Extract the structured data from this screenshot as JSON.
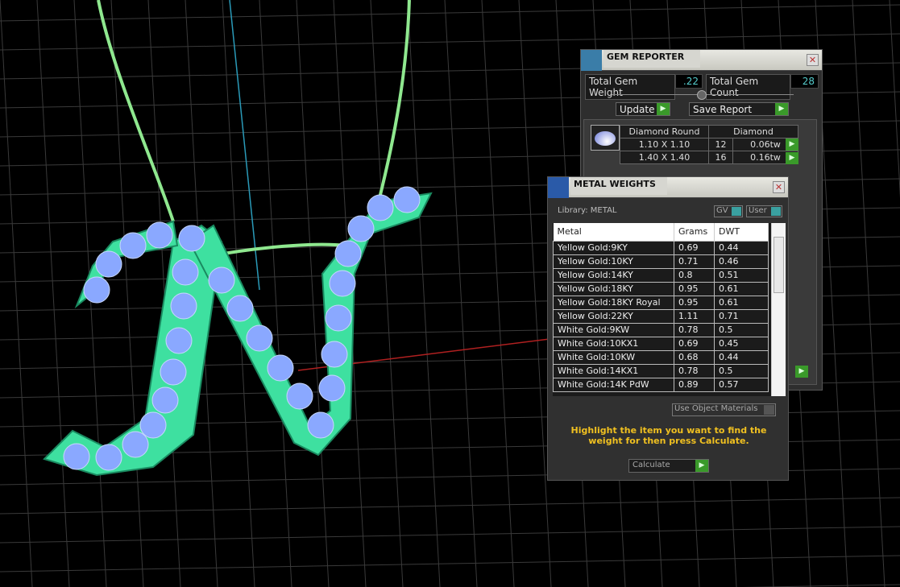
{
  "gem_reporter": {
    "title": "GEM REPORTER",
    "total_weight_label": "Total Gem Weight",
    "total_weight": ".22",
    "total_count_label": "Total Gem Count",
    "total_count": "28",
    "update_label": "Update",
    "save_label": "Save Report",
    "table_headers": [
      "Diamond Round",
      "Diamond"
    ],
    "rows": [
      {
        "size": "1.10 X 1.10",
        "count": "12",
        "weight": "0.06tw"
      },
      {
        "size": "1.40 X 1.40",
        "count": "16",
        "weight": "0.16tw"
      }
    ]
  },
  "metal_weights": {
    "title": "METAL WEIGHTS",
    "library": "Library: METAL",
    "gv_label": "GV",
    "user_label": "User",
    "headers": [
      "Metal",
      "Grams",
      "DWT"
    ],
    "rows": [
      [
        "Yellow Gold:9KY",
        "0.69",
        "0.44"
      ],
      [
        "Yellow Gold:10KY",
        "0.71",
        "0.46"
      ],
      [
        "Yellow Gold:14KY",
        "0.8",
        "0.51"
      ],
      [
        "Yellow Gold:18KY",
        "0.95",
        "0.61"
      ],
      [
        "Yellow Gold:18KY Royal",
        "0.95",
        "0.61"
      ],
      [
        "Yellow Gold:22KY",
        "1.11",
        "0.71"
      ],
      [
        "White Gold:9KW",
        "0.78",
        "0.5"
      ],
      [
        "White Gold:10KX1",
        "0.69",
        "0.45"
      ],
      [
        "White Gold:10KW",
        "0.68",
        "0.44"
      ],
      [
        "White Gold:14KX1",
        "0.78",
        "0.5"
      ],
      [
        "White Gold:14K PdW",
        "0.89",
        "0.57"
      ]
    ],
    "use_object_materials": "Use Object Materials",
    "instruction": "Highlight the item you want to find the weight for then press Calculate.",
    "calculate_label": "Calculate"
  },
  "colors": {
    "metal": "#3ee0a0",
    "gem": "#8aa8ff",
    "chain": "#8fe88f",
    "accent_go": "#3a9a2a",
    "instruction": "#f0c020"
  }
}
